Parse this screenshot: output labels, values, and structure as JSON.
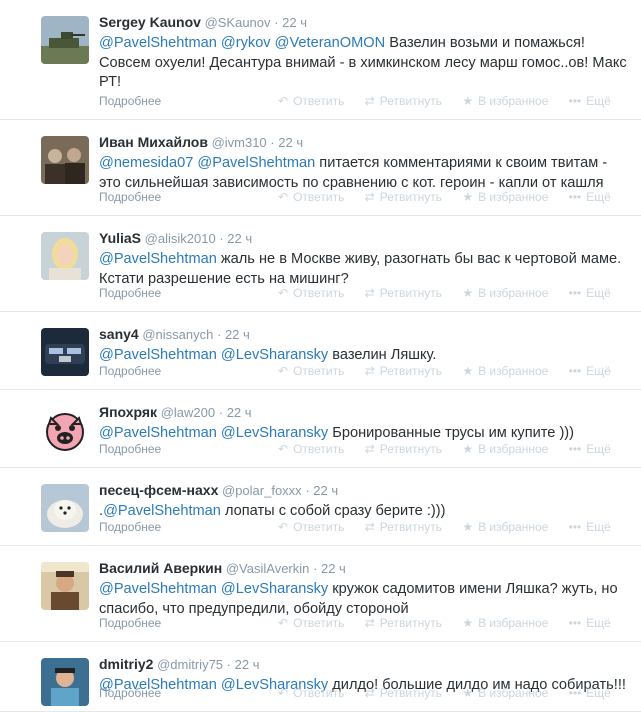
{
  "actions": {
    "expand": "Подробнее",
    "reply": "Ответить",
    "retweet": "Ретвитнуть",
    "favorite": "В избранное",
    "more": "Ещё"
  },
  "icons": {
    "reply": "↶",
    "retweet": "⇄",
    "favorite": "★",
    "more": "•••"
  },
  "tweets": [
    {
      "fullname": "Sergey Kaunov",
      "username": "@SKaunov",
      "time": "22 ч",
      "mentions": [
        "@PavelShehtman",
        "@rykov",
        "@VeteranOMON"
      ],
      "text": " Вазелин возьми и помажься! Совсем охуели! Десантура внимай - в химкинском лесу марш гомос..ов! Макс РТ!"
    },
    {
      "fullname": "Иван Михайлов",
      "username": "@ivm310",
      "time": "22 ч",
      "mentions": [
        "@nemesida07",
        "@PavelShehtman"
      ],
      "text": " питается комментариями к своим твитам - это сильнейшая зависимость по сравнению с кот. героин - капли от кашля"
    },
    {
      "fullname": "YuliaS",
      "username": "@alisik2010",
      "time": "22 ч",
      "mentions": [
        "@PavelShehtman"
      ],
      "text": " жаль не в Москве живу, разогнать бы вас к чертовой маме. Кстати разрешение есть на мишинг?"
    },
    {
      "fullname": "sany4",
      "username": "@nissanych",
      "time": "22 ч",
      "mentions": [
        "@PavelShehtman",
        "@LevSharansky"
      ],
      "text": " вазелин Ляшку."
    },
    {
      "fullname": "Япохряк",
      "username": "@law200",
      "time": "22 ч",
      "mentions": [
        "@PavelShehtman",
        "@LevSharansky"
      ],
      "text": " Бронированные трусы им купите )))"
    },
    {
      "fullname": "песец-фсем-нахх",
      "username": "@polar_foxxx",
      "time": "22 ч",
      "prefix": ".",
      "mentions": [
        "@PavelShehtman"
      ],
      "text": " лопаты с собой сразу берите :)))"
    },
    {
      "fullname": "Василий Аверкин",
      "username": "@VasilAverkin",
      "time": "22 ч",
      "mentions": [
        "@PavelShehtman",
        "@LevSharansky"
      ],
      "text": " кружок садомитов имени Ляшка? жуть, но спасибо, что предупредили, обойду стороной"
    },
    {
      "fullname": "dmitriy2",
      "username": "@dmitriy75",
      "time": "22 ч",
      "mentions": [
        "@PavelShehtman",
        "@LevSharansky"
      ],
      "text": " дилдо! большие дилдо им надо собирать!!!"
    }
  ]
}
